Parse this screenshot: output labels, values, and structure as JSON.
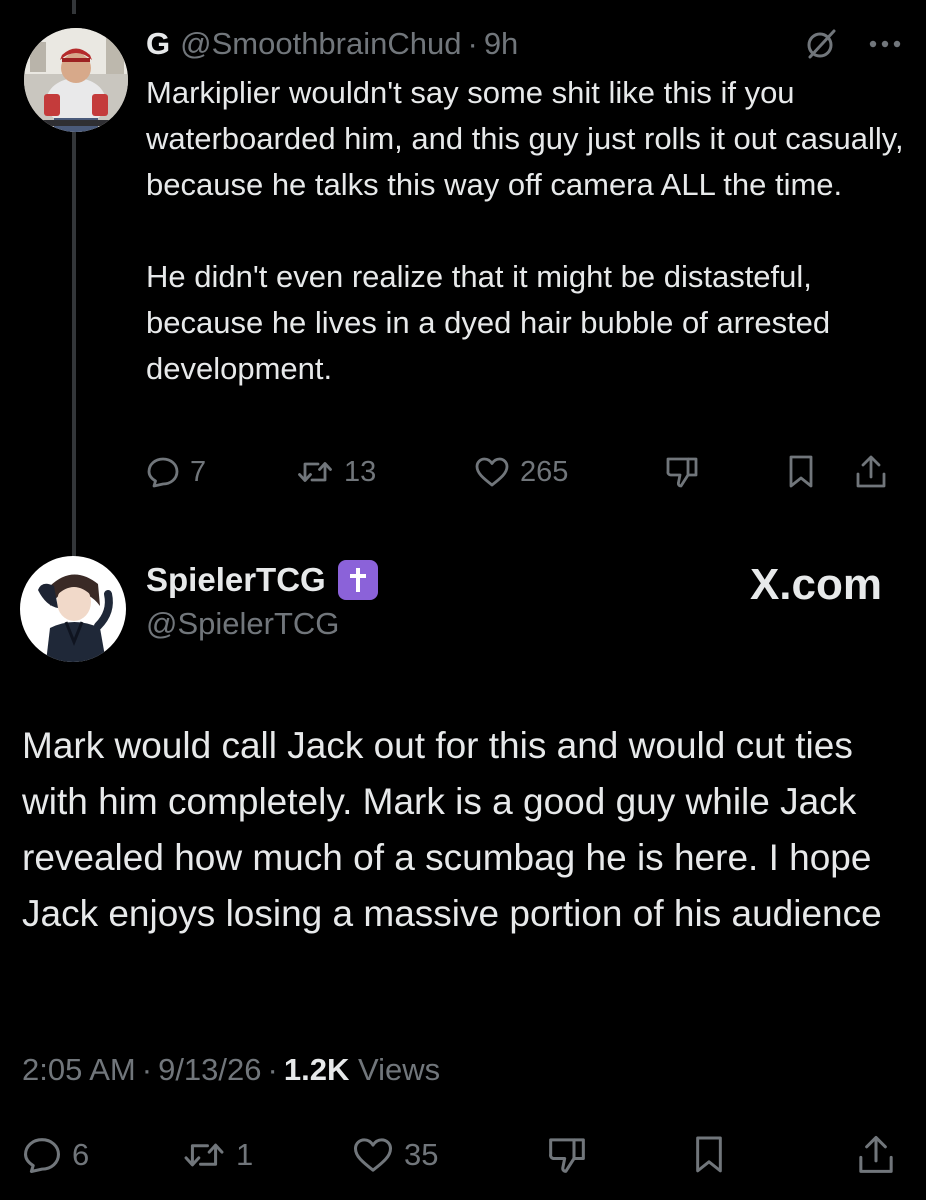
{
  "tweet1": {
    "display_name": "G",
    "handle": "@SmoothbrainChud",
    "separator": "·",
    "time": "9h",
    "paragraphs": [
      "Markiplier wouldn't say some shit like this if you waterboarded him, and this guy just rolls it out casually, because he talks this way off camera ALL the time.",
      "He didn't even realize that it might be distasteful, because he lives in a dyed hair bubble of arrested development."
    ],
    "stats": {
      "replies": "7",
      "reposts": "13",
      "likes": "265"
    }
  },
  "tweet2": {
    "display_name": "SpielerTCG",
    "handle": "@SpielerTCG",
    "badge": "✝",
    "brand": "X.com",
    "text": "Mark would call Jack out for this and would cut ties with him completely. Mark is a good guy while Jack revealed how much of a scumbag he is here. I hope Jack enjoys losing a massive portion of his audience",
    "time": "2:05 AM",
    "date": "9/13/26",
    "views_count": "1.2K",
    "views_label": "Views",
    "separator": "·",
    "stats": {
      "replies": "6",
      "reposts": "1",
      "likes": "35"
    }
  },
  "colors": {
    "background": "#000000",
    "text": "#e7e9ea",
    "muted": "#71767b",
    "thread_line": "#333639",
    "badge": "#8b62d9"
  },
  "icons": {
    "reply": "reply-icon",
    "repost": "repost-icon",
    "like": "heart-icon",
    "downvote": "downvote-icon",
    "bookmark": "bookmark-icon",
    "share": "share-icon",
    "grok": "slashed-circle-icon",
    "more": "more-dots-icon"
  }
}
